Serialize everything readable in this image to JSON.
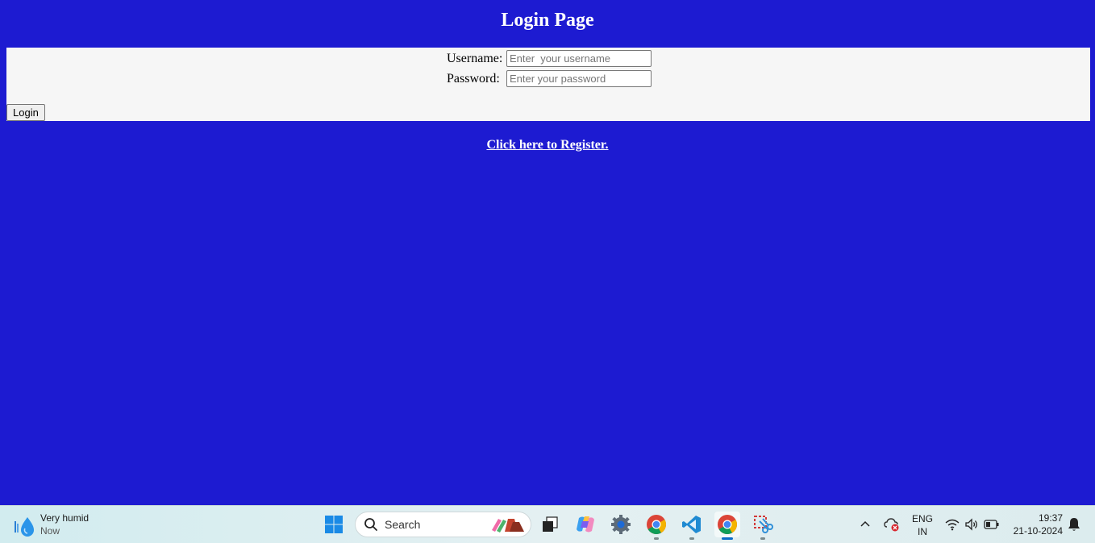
{
  "page": {
    "title": "Login Page",
    "username_label": "Username:",
    "username_placeholder": "Enter  your username",
    "password_label": "Password:",
    "password_placeholder": "Enter your password",
    "login_button": "Login",
    "register_link": "Click here to Register."
  },
  "colors": {
    "background": "#1d1bd1",
    "form_background": "#f6f6f6",
    "title_text": "#ffffff"
  },
  "taskbar": {
    "weather": {
      "condition": "Very humid",
      "time": "Now",
      "icon": "water-drop-icon"
    },
    "search_placeholder": "Search",
    "apps": [
      {
        "name": "start-icon"
      },
      {
        "name": "task-view-icon"
      },
      {
        "name": "copilot-icon"
      },
      {
        "name": "settings-icon"
      },
      {
        "name": "chrome-icon"
      },
      {
        "name": "vscode-icon"
      },
      {
        "name": "chrome-icon",
        "active": true
      },
      {
        "name": "snipping-tool-icon"
      }
    ],
    "tray": {
      "lang_line1": "ENG",
      "lang_line2": "IN",
      "time": "19:37",
      "date": "21-10-2024"
    }
  }
}
